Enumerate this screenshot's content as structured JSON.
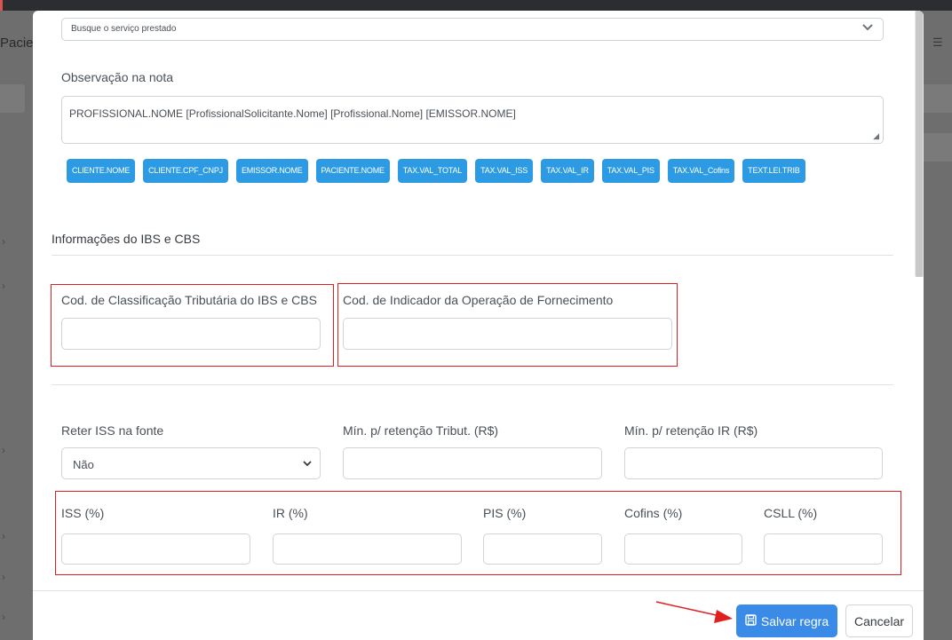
{
  "background": {
    "left_title": "Pacie",
    "right_icon": "list-icon"
  },
  "modal": {
    "servico_select": {
      "placeholder": "Busque o serviço prestado",
      "chevron_icon": "chevron-down-icon"
    },
    "observacao": {
      "label": "Observação na nota",
      "value": "PROFISSIONAL.NOME  [ProfissionalSolicitante.Nome] [Profissional.Nome] [EMISSOR.NOME]"
    },
    "tags": [
      "CLIENTE.NOME",
      "CLIENTE.CPF_CNPJ",
      "EMISSOR.NOME",
      "PACIENTE.NOME",
      "TAX.VAL_TOTAL",
      "TAX.VAL_ISS",
      "TAX.VAL_IR",
      "TAX.VAL_PIS",
      "TAX.VAL_Cofins",
      "TEXT.LEI.TRIB"
    ],
    "ibs_cbs": {
      "title": "Informações do IBS e CBS",
      "classificacao_label": "Cod. de Classificação Tributária do IBS e CBS",
      "classificacao_value": "",
      "indicador_label": "Cod. de Indicador da Operação de Fornecimento",
      "indicador_value": ""
    },
    "retencao": {
      "reter_iss_label": "Reter ISS na fonte",
      "reter_iss_value": "Não",
      "min_tribut_label": "Mín. p/ retenção Tribut. (R$)",
      "min_ir_label": "Mín. p/ retenção IR (R$)"
    },
    "aliquotas": {
      "iss_label": "ISS (%)",
      "ir_label": "IR (%)",
      "pis_label": "PIS (%)",
      "cofins_label": "Cofins (%)",
      "csll_label": "CSLL (%)"
    },
    "footer": {
      "save_label": "Salvar regra",
      "save_icon": "save-icon",
      "cancel_label": "Cancelar"
    }
  },
  "colors": {
    "primary": "#3a8ae8",
    "tag": "#2d9be4",
    "highlight": "#e02020"
  }
}
